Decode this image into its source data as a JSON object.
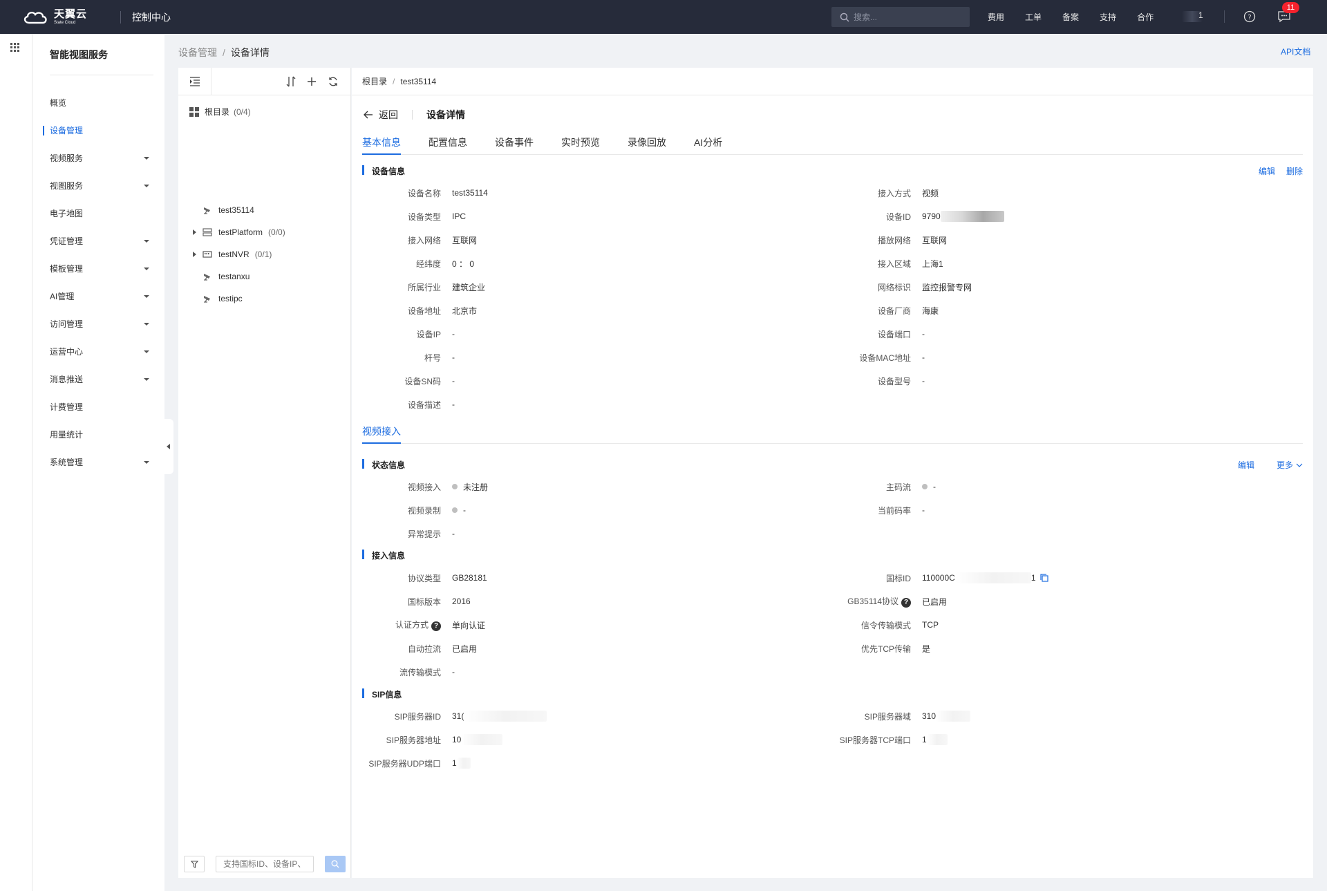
{
  "topbar": {
    "brand_cn": "天翼云",
    "brand_en": "State Cloud",
    "console_title": "控制中心",
    "search_placeholder": "搜索...",
    "nav": [
      "费用",
      "工单",
      "备案",
      "支持",
      "合作"
    ],
    "user_digit": "1",
    "message_count": "11"
  },
  "sidebar": {
    "title": "智能视图服务",
    "items": [
      {
        "label": "概览",
        "has_children": false
      },
      {
        "label": "设备管理",
        "has_children": false,
        "active": true
      },
      {
        "label": "视频服务",
        "has_children": true
      },
      {
        "label": "视图服务",
        "has_children": true
      },
      {
        "label": "电子地图",
        "has_children": false
      },
      {
        "label": "凭证管理",
        "has_children": true
      },
      {
        "label": "模板管理",
        "has_children": true
      },
      {
        "label": "AI管理",
        "has_children": true
      },
      {
        "label": "访问管理",
        "has_children": true
      },
      {
        "label": "运营中心",
        "has_children": true
      },
      {
        "label": "消息推送",
        "has_children": true
      },
      {
        "label": "计费管理",
        "has_children": false
      },
      {
        "label": "用量统计",
        "has_children": false
      },
      {
        "label": "系统管理",
        "has_children": true
      }
    ]
  },
  "breadcrumb": {
    "parent": "设备管理",
    "separator": "/",
    "current": "设备详情"
  },
  "api_doc": "API文档",
  "tree": {
    "root_label": "根目录",
    "root_count": "(0/4)",
    "nodes": [
      {
        "label": "test35114",
        "count": "",
        "type": "camera-icon",
        "expandable": false
      },
      {
        "label": "testPlatform",
        "count": "(0/0)",
        "type": "platform-icon",
        "expandable": true
      },
      {
        "label": "testNVR",
        "count": "(0/1)",
        "type": "nvr-icon",
        "expandable": true
      },
      {
        "label": "testanxu",
        "count": "",
        "type": "camera-icon",
        "expandable": false
      },
      {
        "label": "testipc",
        "count": "",
        "type": "camera-icon",
        "expandable": false
      }
    ],
    "search_placeholder": "支持国标ID、设备IP、"
  },
  "detail": {
    "crumb_root": "根目录",
    "crumb_device": "test35114",
    "back_label": "返回",
    "title": "设备详情",
    "tabs": [
      "基本信息",
      "配置信息",
      "设备事件",
      "实时预览",
      "录像回放",
      "AI分析"
    ],
    "device_info": {
      "title": "设备信息",
      "links": [
        "编辑",
        "删除"
      ],
      "left": [
        {
          "k": "设备名称",
          "v": "test35114"
        },
        {
          "k": "设备类型",
          "v": "IPC"
        },
        {
          "k": "接入网络",
          "v": "互联网"
        },
        {
          "k": "经纬度",
          "v": "0 ： 0"
        },
        {
          "k": "所属行业",
          "v": "建筑企业"
        },
        {
          "k": "设备地址",
          "v": "北京市"
        },
        {
          "k": "设备IP",
          "v": "-"
        },
        {
          "k": "杆号",
          "v": "-"
        },
        {
          "k": "设备SN码",
          "v": "-"
        },
        {
          "k": "设备描述",
          "v": "-"
        }
      ],
      "right": [
        {
          "k": "接入方式",
          "v": "视频"
        },
        {
          "k": "设备ID",
          "v": "9790"
        },
        {
          "k": "播放网络",
          "v": "互联网"
        },
        {
          "k": "接入区域",
          "v": "上海1"
        },
        {
          "k": "网络标识",
          "v": "监控报警专网"
        },
        {
          "k": "设备厂商",
          "v": "海康"
        },
        {
          "k": "设备端口",
          "v": "-"
        },
        {
          "k": "设备MAC地址",
          "v": "-"
        },
        {
          "k": "设备型号",
          "v": "-"
        }
      ]
    },
    "subtab": "视频接入",
    "status_info": {
      "title": "状态信息",
      "links": [
        "编辑",
        "更多"
      ],
      "rows": [
        {
          "k": "视频接入",
          "v": "未注册",
          "dot": true
        },
        {
          "k": "视频录制",
          "v": "-",
          "dot": true
        },
        {
          "k": "异常提示",
          "v": "-",
          "dot": false
        }
      ],
      "right": [
        {
          "k": "主码流",
          "v": "-",
          "dot": true
        },
        {
          "k": "当前码率",
          "v": "-",
          "dot": false
        }
      ]
    },
    "access_info": {
      "title": "接入信息",
      "left": [
        {
          "k": "协议类型",
          "v": "GB28181",
          "help": false
        },
        {
          "k": "国标版本",
          "v": "2016",
          "help": false
        },
        {
          "k": "认证方式",
          "v": "单向认证",
          "help": true
        },
        {
          "k": "自动拉流",
          "v": "已启用",
          "help": false
        },
        {
          "k": "流传输模式",
          "v": "-",
          "help": false
        }
      ],
      "right": [
        {
          "k": "国标ID",
          "v": "110000C",
          "help": false
        },
        {
          "k": "GB35114协议",
          "v": "已启用",
          "help": true
        },
        {
          "k": "信令传输模式",
          "v": "TCP",
          "help": false
        },
        {
          "k": "优先TCP传输",
          "v": "是",
          "help": false
        }
      ],
      "gb_id_tail": "1"
    },
    "sip_info": {
      "title": "SIP信息",
      "left": [
        {
          "k": "SIP服务器ID",
          "v": "31("
        },
        {
          "k": "SIP服务器地址",
          "v": "10"
        },
        {
          "k": "SIP服务器UDP端口",
          "v": "1"
        }
      ],
      "right": [
        {
          "k": "SIP服务器域",
          "v": "310"
        },
        {
          "k": "SIP服务器TCP端口",
          "v": "1"
        }
      ]
    }
  },
  "colors": {
    "accent": "#1c6ce0",
    "topbar": "#262b3a",
    "badge": "#f5222d"
  }
}
